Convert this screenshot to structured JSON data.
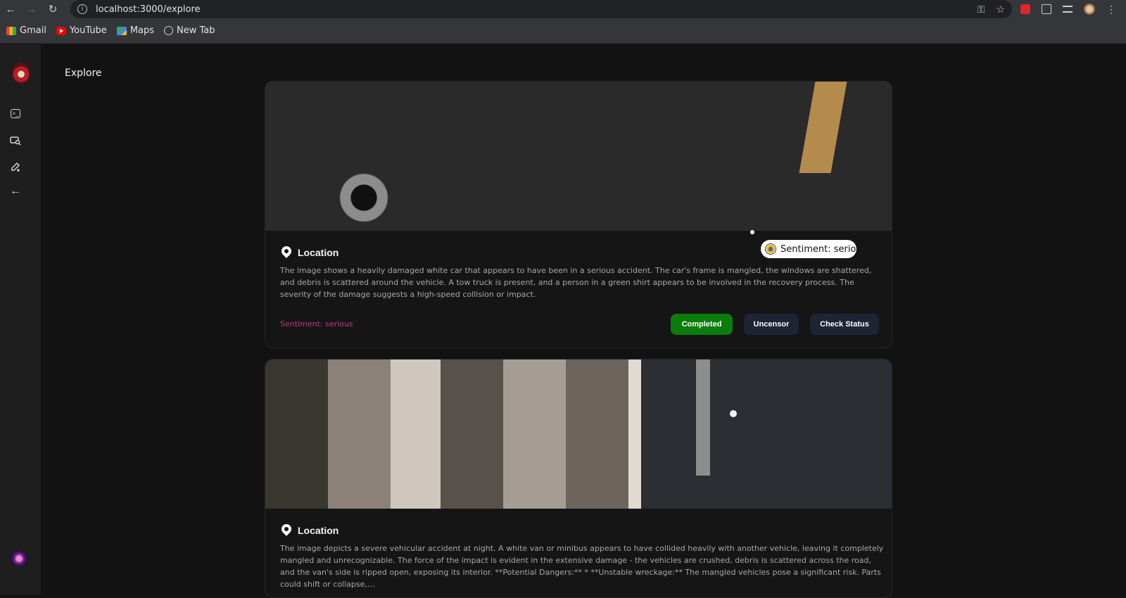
{
  "browser": {
    "url": "localhost:3000/explore",
    "bookmarks": [
      {
        "label": "Gmail",
        "icon": "gmail-icon"
      },
      {
        "label": "YouTube",
        "icon": "youtube-icon"
      },
      {
        "label": "Maps",
        "icon": "maps-icon"
      },
      {
        "label": "New Tab",
        "icon": "globe-icon"
      }
    ]
  },
  "sidebar": {
    "items": [
      {
        "name": "terminal-icon"
      },
      {
        "name": "search-icon"
      },
      {
        "name": "edit-icon"
      },
      {
        "name": "back-arrow-icon"
      }
    ]
  },
  "page": {
    "title": "Explore"
  },
  "cards": [
    {
      "location_label": "Location",
      "description": "The image shows a heavily damaged white car that appears to have been in a serious accident. The car's frame is mangled, the windows are shattered, and debris is scattered around the vehicle. A tow truck is present, and a person in a green shirt appears to be involved in the recovery process. The severity of the damage suggests a high-speed collision or impact.",
      "sentiment": "Sentiment: serious",
      "buttons": {
        "completed": "Completed",
        "uncensor": "Uncensor",
        "check_status": "Check Status"
      }
    },
    {
      "location_label": "Location",
      "description": "The image depicts a severe vehicular accident at night. A white van or minibus appears to have collided heavily with another vehicle, leaving it completely mangled and unrecognizable. The force of the impact is evident in the extensive damage - the vehicles are crushed, debris is scattered across the road, and the van's side is ripped open, exposing its interior. **Potential Dangers:** * **Unstable wreckage:** The mangled vehicles pose a significant risk. Parts could shift or collapse,…"
    }
  ],
  "tooltip": {
    "text": "Sentiment: serious"
  },
  "colors": {
    "completed": "#0a7d0a",
    "secondary_button": "#1e2433",
    "sentiment": "#c2368f"
  }
}
